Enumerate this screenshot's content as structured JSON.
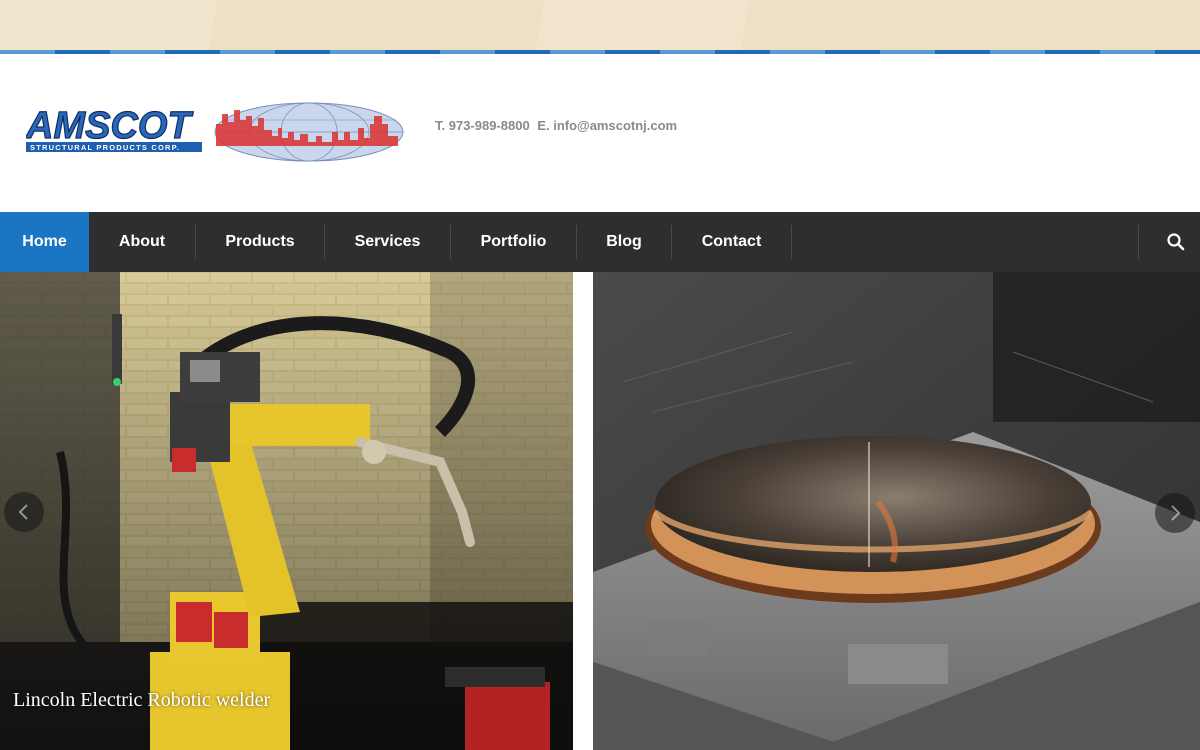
{
  "brand": {
    "name": "AMSCOT",
    "tagline": "STRUCTURAL PRODUCTS CORP.",
    "colors": {
      "blue": "#1f5fb0",
      "red": "#d83a3a",
      "accent": "#1a76c3",
      "nav_bg": "#2e2e2e"
    }
  },
  "header": {
    "phone": "T. 973-989-8800",
    "email": "E. info@amscotnj.com"
  },
  "nav": {
    "items": [
      {
        "label": "Home",
        "active": true
      },
      {
        "label": "About",
        "active": false
      },
      {
        "label": "Products",
        "active": false
      },
      {
        "label": "Services",
        "active": false
      },
      {
        "label": "Portfolio",
        "active": false
      },
      {
        "label": "Blog",
        "active": false
      },
      {
        "label": "Contact",
        "active": false
      }
    ],
    "search_icon": "search-icon"
  },
  "slider": {
    "caption": "Lincoln Electric Robotic welder",
    "prev_icon": "chevron-left-icon",
    "next_icon": "chevron-right-icon"
  }
}
